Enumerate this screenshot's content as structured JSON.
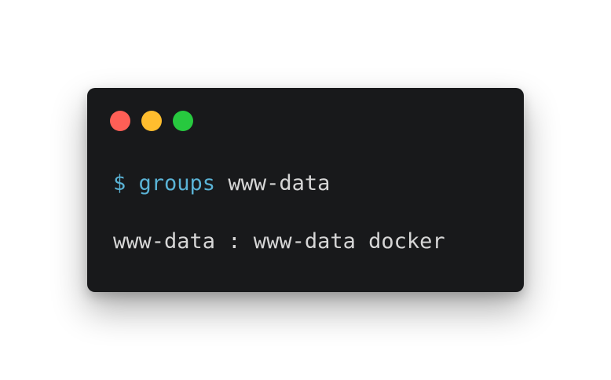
{
  "window_controls": {
    "close_color": "#ff5f56",
    "minimize_color": "#ffbd2e",
    "maximize_color": "#27c93f"
  },
  "terminal": {
    "background": "#18191b",
    "command_line": {
      "prompt": "$",
      "command": "groups",
      "argument": "www-data"
    },
    "output_line": "www-data : www-data docker"
  },
  "colors": {
    "command_accent": "#5ab3d6",
    "text": "#d6d6d6"
  }
}
